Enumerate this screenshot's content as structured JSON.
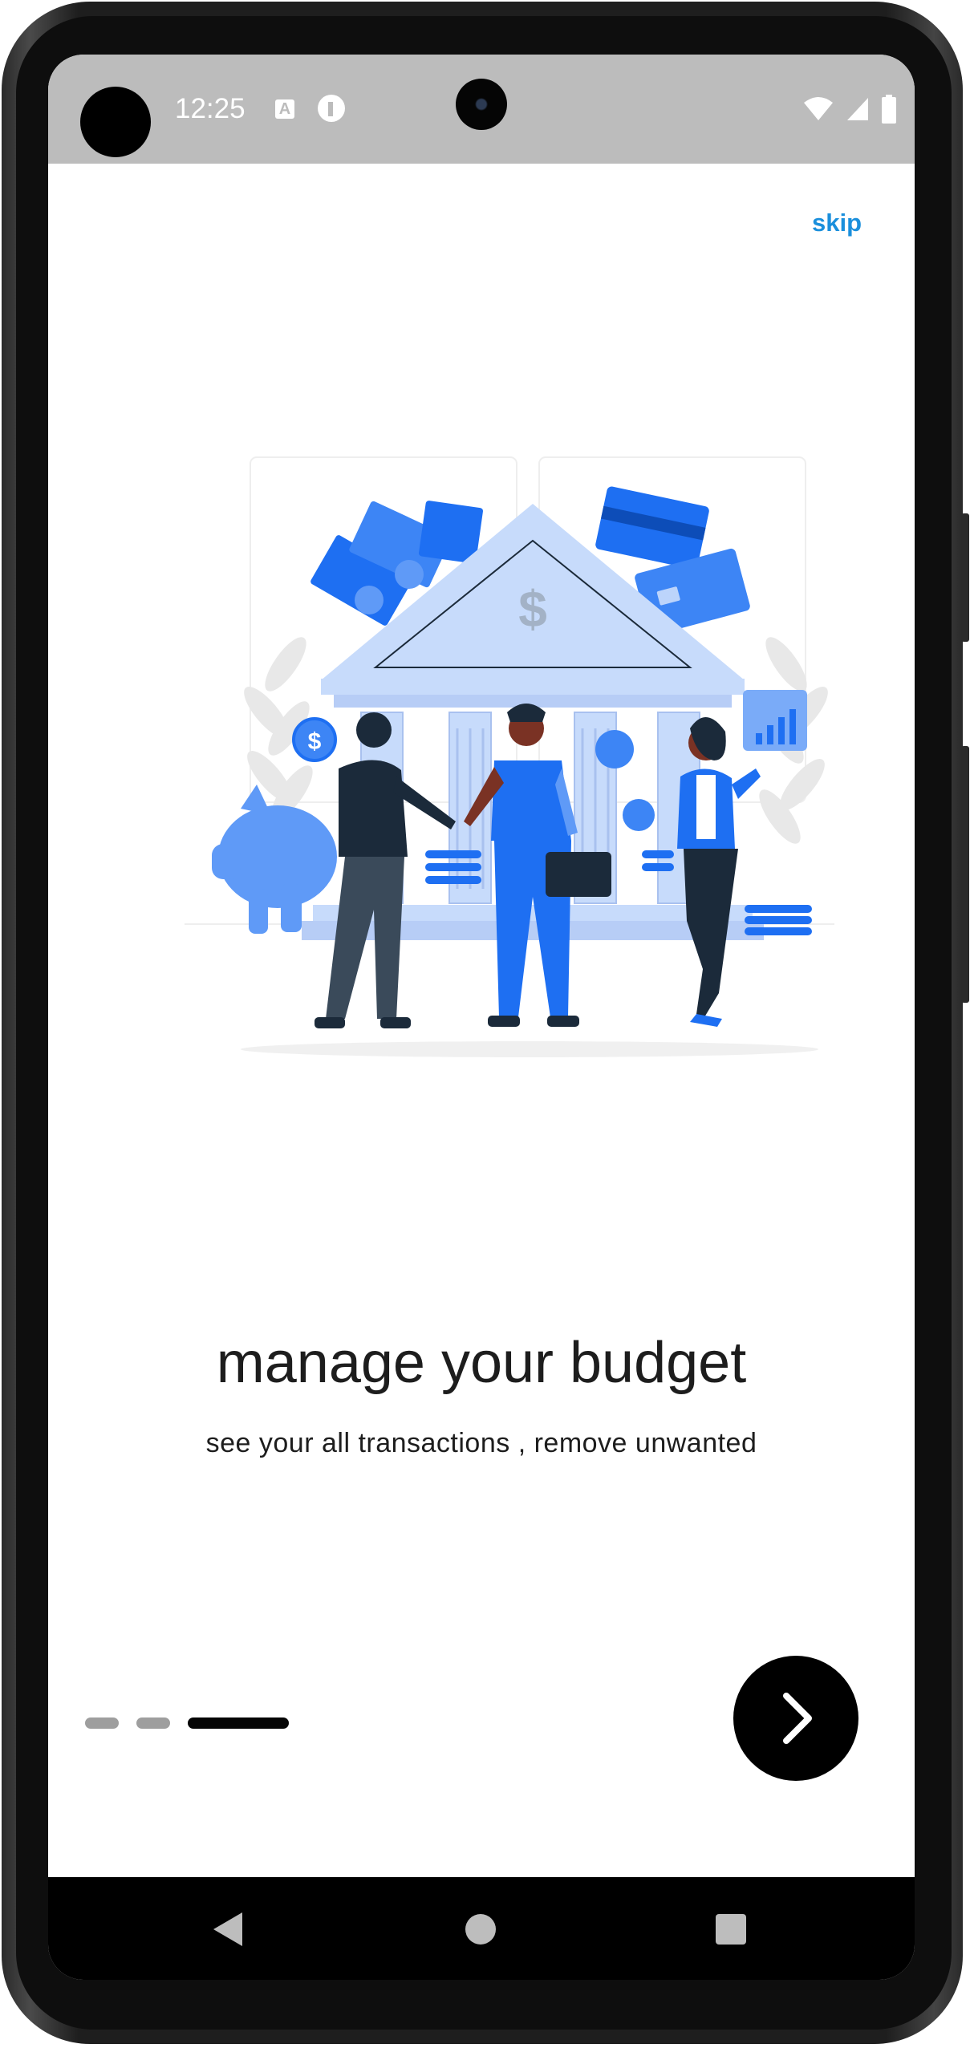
{
  "status_bar": {
    "time": "12:25",
    "notif_a": "A"
  },
  "onboarding": {
    "skip_label": "skip",
    "title": "manage your budget",
    "subtitle": "see your all transactions , remove unwanted",
    "page_indicator": {
      "total": 3,
      "active_index": 2
    }
  },
  "colors": {
    "accent": "#1a8fdc",
    "illustration_blue": "#1e6ff2",
    "light_blue": "#c7dbfb",
    "next_button": "#000000"
  },
  "icons": {
    "next": "chevron-right-icon",
    "nav_back": "back-triangle-icon",
    "nav_home": "home-circle-icon",
    "nav_recent": "recents-square-icon"
  }
}
